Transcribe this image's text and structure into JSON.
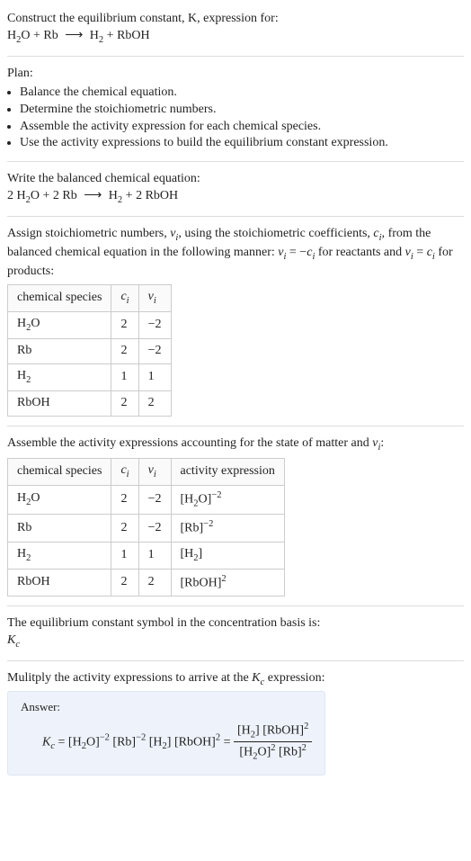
{
  "intro": {
    "line1": "Construct the equilibrium constant, K, expression for:",
    "equation_lhs1": "H",
    "equation_lhs1_sub": "2",
    "equation_lhs1b": "O + Rb",
    "arrow": "⟶",
    "equation_rhs1": "H",
    "equation_rhs1_sub": "2",
    "equation_rhs1b": " + RbOH"
  },
  "plan": {
    "title": "Plan:",
    "items": [
      "Balance the chemical equation.",
      "Determine the stoichiometric numbers.",
      "Assemble the activity expression for each chemical species.",
      "Use the activity expressions to build the equilibrium constant expression."
    ]
  },
  "balanced": {
    "title": "Write the balanced chemical equation:",
    "lhs": "2 H",
    "lhs_sub": "2",
    "lhs_b": "O + 2 Rb",
    "arrow": "⟶",
    "rhs": "H",
    "rhs_sub": "2",
    "rhs_b": " + 2 RbOH"
  },
  "stoich": {
    "intro_a": "Assign stoichiometric numbers, ",
    "nu": "ν",
    "nu_sub": "i",
    "intro_b": ", using the stoichiometric coefficients, ",
    "c": "c",
    "c_sub": "i",
    "intro_c": ", from the balanced chemical equation in the following manner: ",
    "rel1": "ν",
    "rel1_sub": "i",
    "rel1_eq": " = −",
    "rel1_c": "c",
    "rel1_csub": "i",
    "rel2_txt": " for reactants and ",
    "rel3": "ν",
    "rel3_sub": "i",
    "rel3_eq": " = ",
    "rel3_c": "c",
    "rel3_csub": "i",
    "rel4_txt": " for products:",
    "head": {
      "col1": "chemical species",
      "col2": "c",
      "col2_sub": "i",
      "col3": "ν",
      "col3_sub": "i"
    },
    "rows": [
      {
        "sp_a": "H",
        "sp_sub": "2",
        "sp_b": "O",
        "c": "2",
        "v": "−2"
      },
      {
        "sp_a": "Rb",
        "sp_sub": "",
        "sp_b": "",
        "c": "2",
        "v": "−2"
      },
      {
        "sp_a": "H",
        "sp_sub": "2",
        "sp_b": "",
        "c": "1",
        "v": "1"
      },
      {
        "sp_a": "RbOH",
        "sp_sub": "",
        "sp_b": "",
        "c": "2",
        "v": "2"
      }
    ]
  },
  "activity": {
    "intro_a": "Assemble the activity expressions accounting for the state of matter and ",
    "nu": "ν",
    "nu_sub": "i",
    "colon": ":",
    "head": {
      "col1": "chemical species",
      "col2": "c",
      "col2_sub": "i",
      "col3": "ν",
      "col3_sub": "i",
      "col4": "activity expression"
    },
    "rows": [
      {
        "sp_a": "H",
        "sp_sub": "2",
        "sp_b": "O",
        "c": "2",
        "v": "−2",
        "act_a": "[H",
        "act_sub": "2",
        "act_b": "O]",
        "act_pow": "−2"
      },
      {
        "sp_a": "Rb",
        "sp_sub": "",
        "sp_b": "",
        "c": "2",
        "v": "−2",
        "act_a": "[Rb]",
        "act_sub": "",
        "act_b": "",
        "act_pow": "−2"
      },
      {
        "sp_a": "H",
        "sp_sub": "2",
        "sp_b": "",
        "c": "1",
        "v": "1",
        "act_a": "[H",
        "act_sub": "2",
        "act_b": "]",
        "act_pow": ""
      },
      {
        "sp_a": "RbOH",
        "sp_sub": "",
        "sp_b": "",
        "c": "2",
        "v": "2",
        "act_a": "[RbOH]",
        "act_sub": "",
        "act_b": "",
        "act_pow": "2"
      }
    ]
  },
  "symbol": {
    "line": "The equilibrium constant symbol in the concentration basis is:",
    "K": "K",
    "K_sub": "c"
  },
  "mult": {
    "line": "Mulitply the activity expressions to arrive at the ",
    "K": "K",
    "K_sub": "c",
    "tail": " expression:"
  },
  "answer": {
    "label": "Answer:",
    "formula": {
      "K": "K",
      "K_sub": "c",
      "eq": " = ",
      "t1": "[H",
      "t1_sub": "2",
      "t1b": "O]",
      "t1_pow": "−2",
      "sp1": " ",
      "t2": "[Rb]",
      "t2_pow": "−2",
      "sp2": " ",
      "t3": "[H",
      "t3_sub": "2",
      "t3b": "]",
      "sp3": " ",
      "t4": "[RbOH]",
      "t4_pow": "2",
      "eq2": " = ",
      "num": "[H",
      "num_sub": "2",
      "num_b": "] [RbOH]",
      "num_pow": "2",
      "den": "[H",
      "den_sub": "2",
      "den_b": "O]",
      "den_pow": "2",
      "den_sp": " [Rb]",
      "den_pow2": "2"
    }
  }
}
